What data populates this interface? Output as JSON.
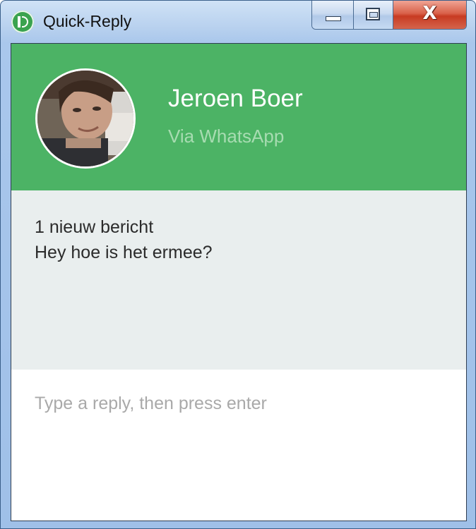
{
  "window": {
    "title": "Quick-Reply",
    "buttons": {
      "minimize": "minimize",
      "maximize": "maximize",
      "close": "X"
    }
  },
  "contact": {
    "name": "Jeroen Boer",
    "source": "Via WhatsApp",
    "avatar_icon": "contact-avatar"
  },
  "message": {
    "count_text": "1 nieuw bericht",
    "body": "Hey hoe is het ermee?"
  },
  "reply": {
    "value": "",
    "placeholder": "Type a reply, then press enter"
  },
  "colors": {
    "header_green": "#4cb365",
    "source_text": "#a7dcb1",
    "message_bg": "#e9eeee"
  }
}
